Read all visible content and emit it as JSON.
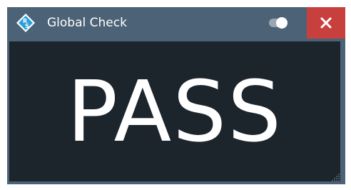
{
  "window": {
    "title": "Global Check"
  },
  "content": {
    "result": "PASS"
  },
  "colors": {
    "titlebar": "#4c6276",
    "close": "#c8403d",
    "content_bg": "#1c242c",
    "result_text": "#ffffff"
  },
  "icons": {
    "logo": "rohde-schwarz-logo-icon",
    "toggle": "toggle-switch-icon",
    "close": "close-icon",
    "grip": "resize-grip-icon"
  }
}
